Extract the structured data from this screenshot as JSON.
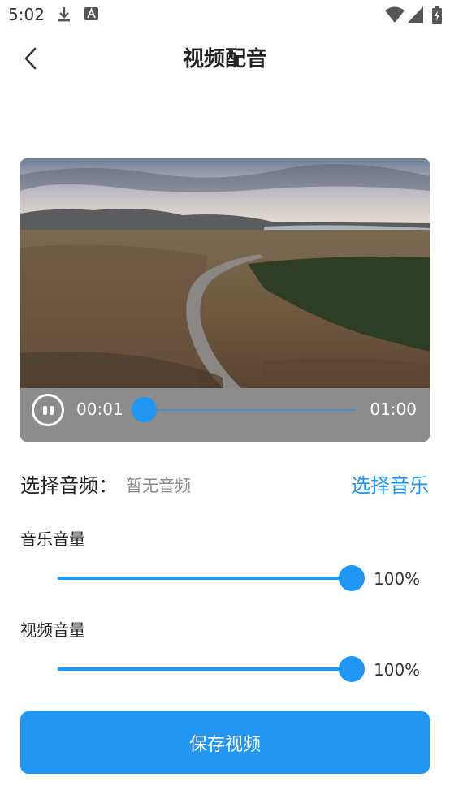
{
  "status_bar": {
    "time": "5:02",
    "icons": [
      "download-icon",
      "font-a-icon",
      "wifi-icon",
      "cell-signal-icon",
      "battery-charging-icon"
    ]
  },
  "header": {
    "title": "视频配音",
    "back_icon": "chevron-left-icon"
  },
  "video": {
    "current_time": "00:01",
    "total_time": "01:00",
    "progress": 0.02,
    "state": "playing",
    "pause_icon": "pause-circle-icon"
  },
  "audio": {
    "label": "选择音频：",
    "value": "暂无音频",
    "choose_label": "选择音乐"
  },
  "music_volume": {
    "label": "音乐音量",
    "percent_text": "100%",
    "level": 1.0
  },
  "video_volume": {
    "label": "视频音量",
    "percent_text": "100%",
    "level": 1.0
  },
  "save_button": {
    "label": "保存视频"
  },
  "colors": {
    "accent": "#2196f3",
    "control_bar": "#8c8c8c"
  }
}
